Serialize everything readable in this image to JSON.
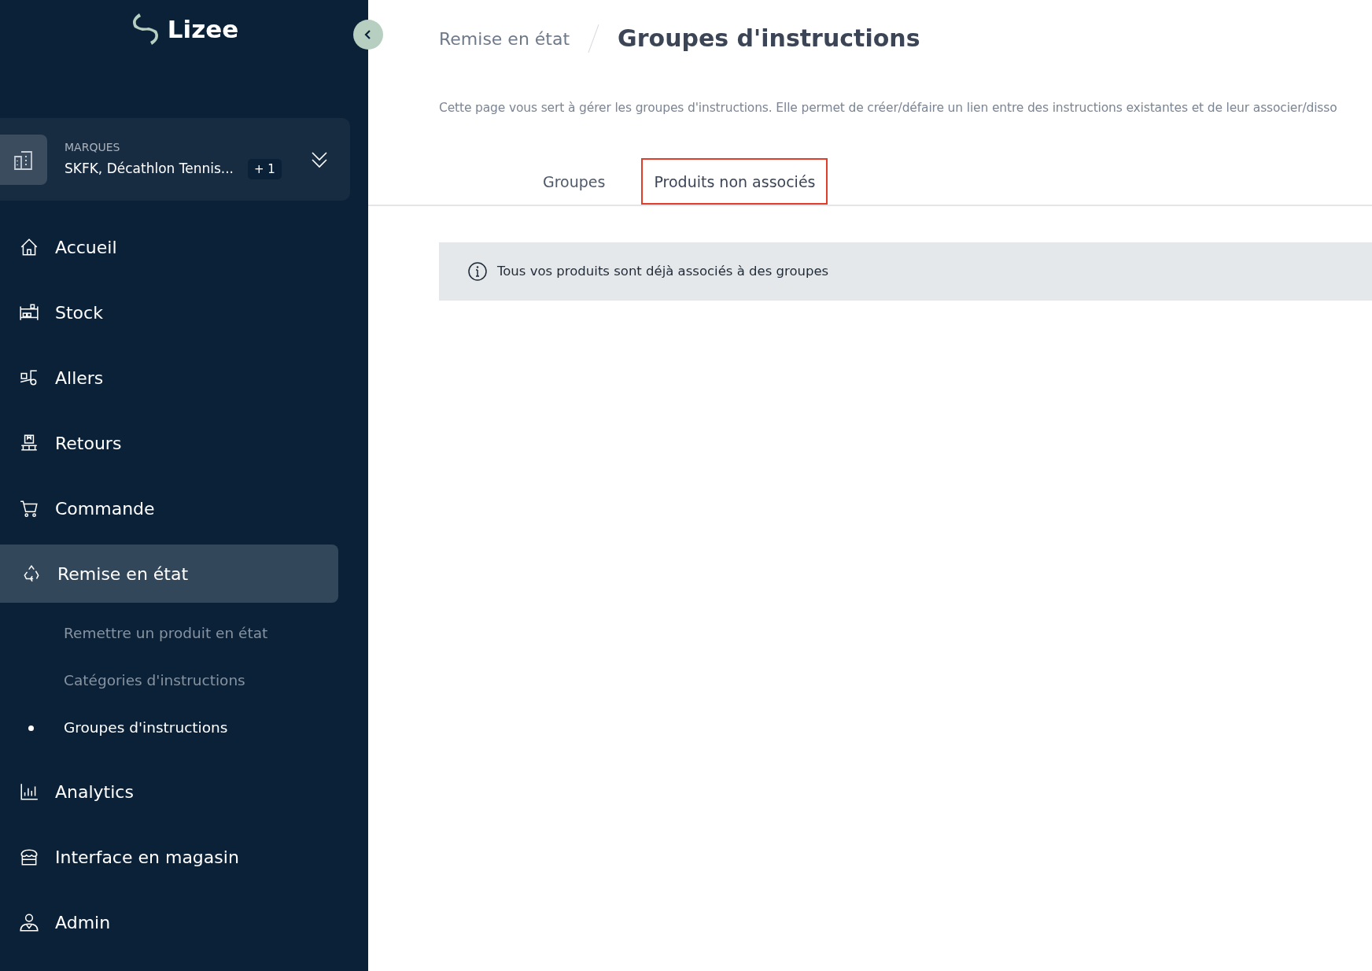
{
  "sidebar": {
    "logo": "Lizee",
    "brand_selector": {
      "label": "MARQUES",
      "value": "SKFK, Décathlon Tennis...",
      "count": "+ 1"
    },
    "items": [
      {
        "label": "Accueil",
        "selected": false
      },
      {
        "label": "Stock",
        "selected": false
      },
      {
        "label": "Allers",
        "selected": false
      },
      {
        "label": "Retours",
        "selected": false
      },
      {
        "label": "Commande",
        "selected": false
      },
      {
        "label": "Remise en état",
        "selected": true,
        "children": [
          {
            "label": "Remettre un produit en état",
            "selected": false
          },
          {
            "label": "Catégories d'instructions",
            "selected": false
          },
          {
            "label": "Groupes d'instructions",
            "selected": true
          }
        ]
      },
      {
        "label": "Analytics",
        "selected": false
      },
      {
        "label": "Interface en magasin",
        "selected": false
      },
      {
        "label": "Admin",
        "selected": false
      }
    ]
  },
  "breadcrumb": {
    "parent": "Remise en état",
    "current": "Groupes d'instructions"
  },
  "description": "Cette page vous sert à gérer les groupes d'instructions. Elle permet de créer/défaire un lien entre des instructions existantes et de leur associer/disso",
  "tabs": [
    {
      "label": "Groupes",
      "selected": false
    },
    {
      "label": "Produits non associés",
      "selected": true
    }
  ],
  "alert": {
    "text": "Tous vos produits sont déjà associés à des groupes"
  }
}
